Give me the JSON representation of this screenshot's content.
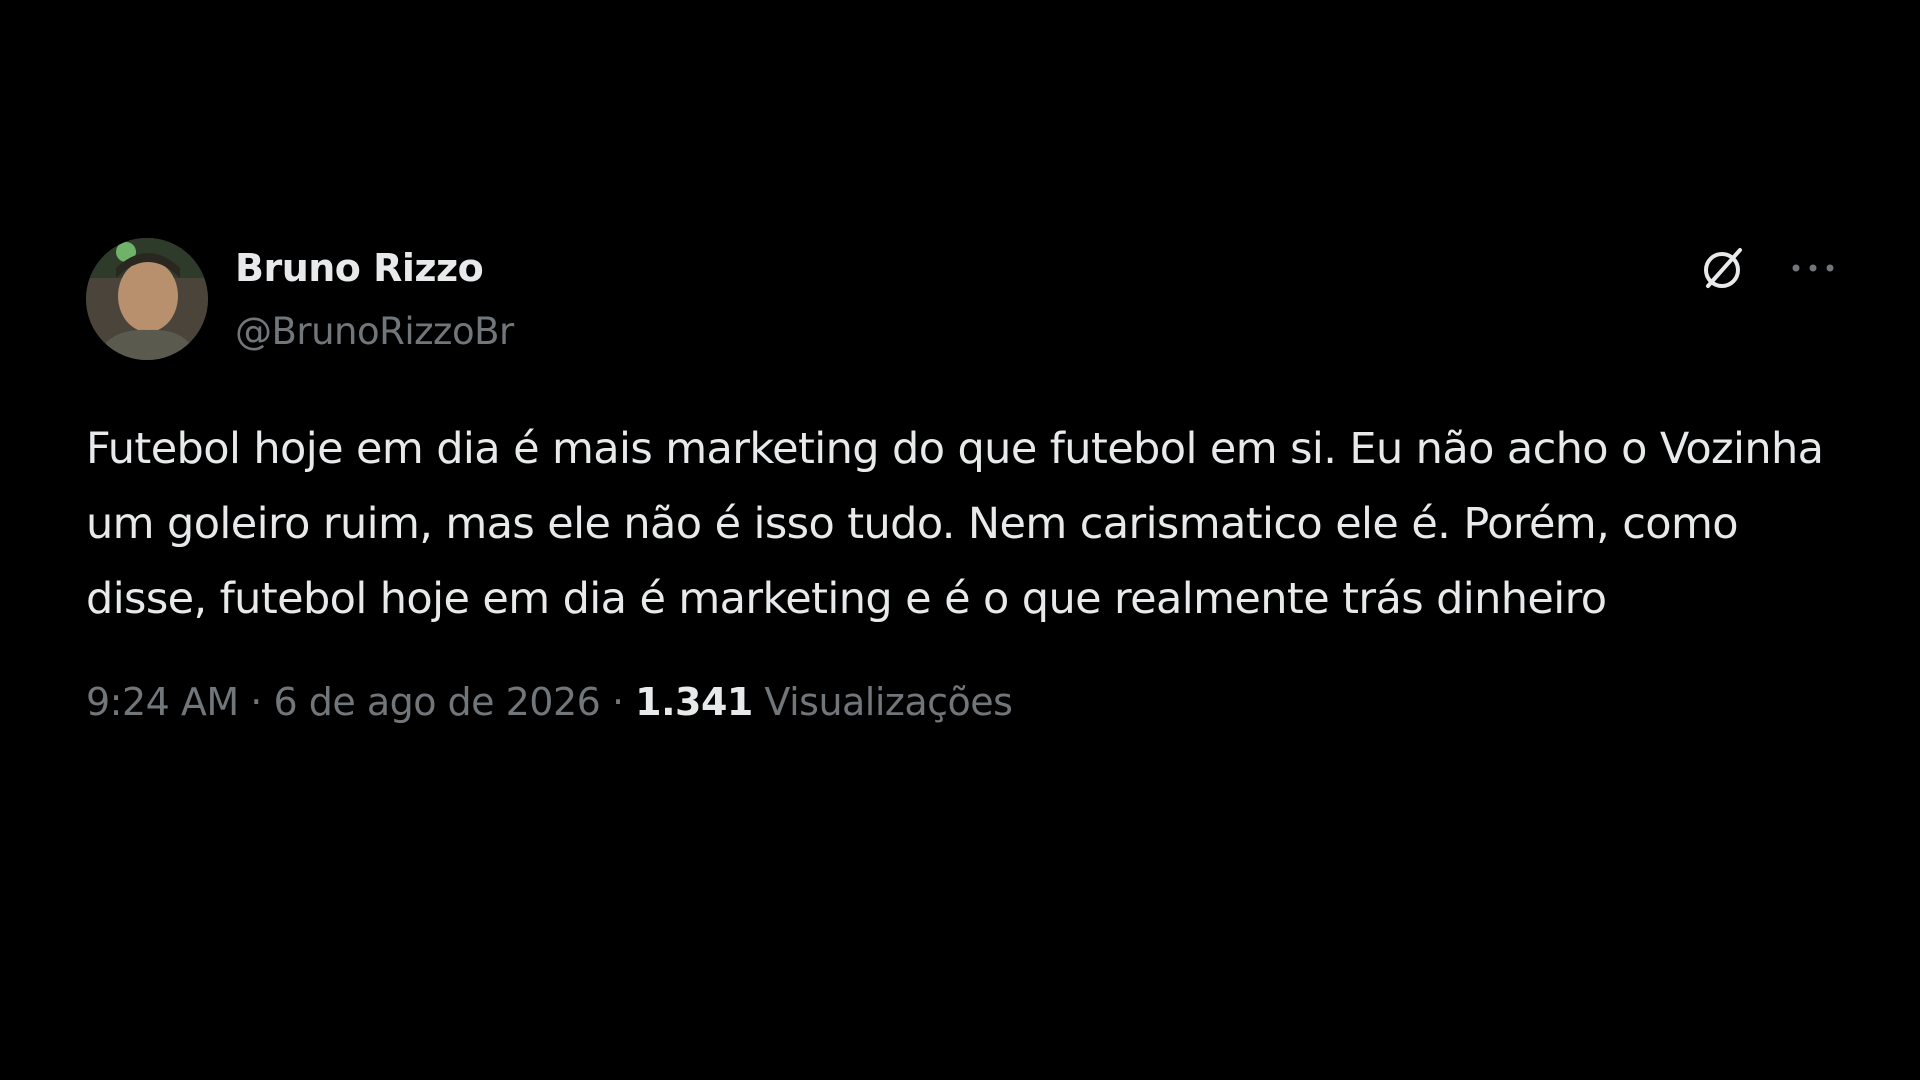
{
  "colors": {
    "background": "#000000",
    "primary_text": "#e7e9ea",
    "secondary_text": "#71767b"
  },
  "tweet": {
    "author": {
      "display_name": "Bruno Rizzo",
      "handle": "@BrunoRizzoBr",
      "avatar_icon": "user-avatar-photo"
    },
    "header_actions": {
      "grok_icon": "grok-slash-circle-icon",
      "more_icon": "more-dots-icon"
    },
    "text": "Futebol hoje em dia é mais marketing do que futebol em si. Eu não acho o Vozinha um goleiro ruim, mas ele não é isso tudo. Nem carismatico ele é. Porém, como disse, futebol hoje em dia é marketing e é o que realmente trás dinheiro",
    "meta": {
      "time": "9:24 AM",
      "separator": "·",
      "date": "6 de ago de 2026",
      "views_count": "1.341",
      "views_label": "Visualizações"
    }
  }
}
